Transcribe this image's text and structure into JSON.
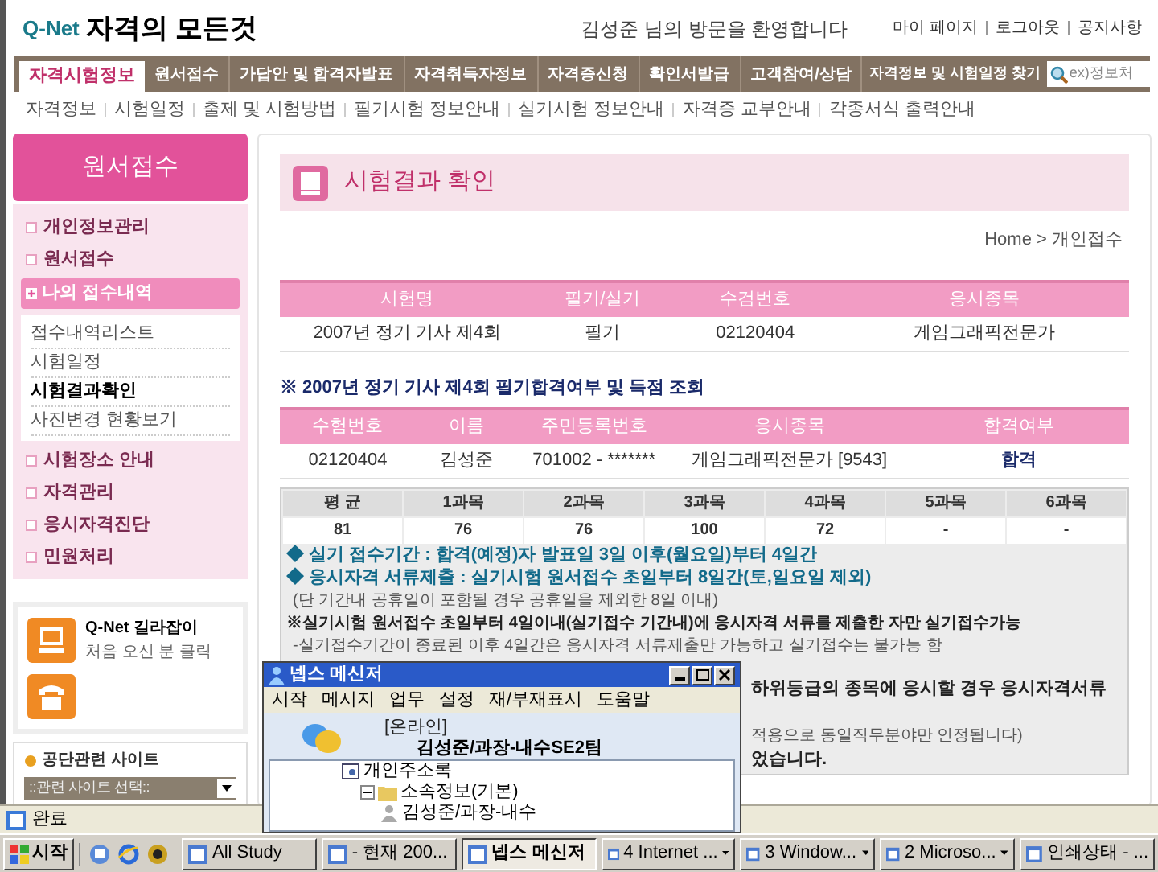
{
  "header": {
    "logo": "Q-Net",
    "site_title": "자격의 모든것",
    "welcome": "김성준 님의 방문을 환영합니다",
    "links": [
      "마이 페이지",
      "로그아웃",
      "공지사항"
    ]
  },
  "main_nav": {
    "tabs": [
      {
        "label": "자격시험정보",
        "selected": true
      },
      {
        "label": "원서접수",
        "selected": false
      },
      {
        "label": "가답안 및 합격자발표",
        "selected": false
      },
      {
        "label": "자격취득자정보",
        "selected": false
      },
      {
        "label": "자격증신청",
        "selected": false
      },
      {
        "label": "확인서발급",
        "selected": false
      },
      {
        "label": "고객참여/상담",
        "selected": false
      }
    ],
    "search_label": "자격정보 및 시험일정 찾기",
    "search_placeholder": "ex)정보처"
  },
  "sub_nav": [
    "자격정보",
    "시험일정",
    "출제 및 시험방법",
    "필기시험 정보안내",
    "실기시험 정보안내",
    "자격증 교부안내",
    "각종서식 출력안내"
  ],
  "sidebar": {
    "title": "원서접수",
    "items": [
      {
        "label": "개인정보관리",
        "expanded": false
      },
      {
        "label": "원서접수",
        "expanded": false
      },
      {
        "label": "나의 접수내역",
        "expanded": true,
        "children": [
          {
            "label": "접수내역리스트",
            "selected": false
          },
          {
            "label": "시험일정",
            "selected": false
          },
          {
            "label": "시험결과확인",
            "selected": true
          },
          {
            "label": "사진변경 현황보기",
            "selected": false
          }
        ]
      },
      {
        "label": "시험장소 안내",
        "expanded": false
      },
      {
        "label": "자격관리",
        "expanded": false
      },
      {
        "label": "응시자격진단",
        "expanded": false
      },
      {
        "label": "민원처리",
        "expanded": false
      }
    ],
    "guide": {
      "title": "Q-Net 길라잡이",
      "subtitle": "처음 오신 분 클릭"
    },
    "related_sites": {
      "title": "공단관련 사이트",
      "select": "::관련 사이트 선택::"
    }
  },
  "page_title": "시험결과 확인",
  "breadcrumb": "Home > 개인접수",
  "exam_table": {
    "columns": [
      "시험명",
      "필기/실기",
      "수검번호",
      "응시종목"
    ],
    "rows": [
      [
        "2007년 정기 기사 제4회",
        "필기",
        "02120404",
        "게임그래픽전문가"
      ]
    ]
  },
  "result_heading": "※ 2007년 정기 기사 제4회 필기합격여부 및 득점 조회",
  "result_table": {
    "columns": [
      "수험번호",
      "이름",
      "주민등록번호",
      "응시종목",
      "합격여부"
    ],
    "rows": [
      [
        "02120404",
        "김성준",
        "701002 - *******",
        "게임그래픽전문가 [9543]",
        "합격"
      ]
    ]
  },
  "score_table": {
    "columns": [
      "평 균",
      "1과목",
      "2과목",
      "3과목",
      "4과목",
      "5과목",
      "6과목"
    ],
    "values": [
      "81",
      "76",
      "76",
      "100",
      "72",
      "-",
      "-"
    ]
  },
  "notes": [
    {
      "kind": "highlight",
      "text": "◆ 실기 접수기간 : 합격(예정)자 발표일 3일 이후(월요일)부터 4일간"
    },
    {
      "kind": "highlight",
      "text": "◆ 응시자격 서류제출 : 실기시험 원서접수 초일부터 8일간(토,일요일 제외)"
    },
    {
      "kind": "note",
      "text": "(단 기간내 공휴일이 포함될 경우 공휴일을 제외한 8일 이내)"
    },
    {
      "kind": "warning",
      "text": "※실기시험 원서접수 초일부터 4일이내(실기접수 기간내)에 응시자격 서류를 제출한 자만 실기접수가능"
    },
    {
      "kind": "note",
      "text": "-실기접수기간이 종료된 이후 4일간은 응시자격 서류제출만 가능하고 실기접수는 불가능 함"
    },
    {
      "kind": "covered_warning",
      "text": "하위등급의 종목에 응시할 경우 응시자격서류"
    },
    {
      "kind": "covered_note",
      "text": "적용으로 동일직무분야만 인정됩니다)"
    },
    {
      "kind": "covered_end",
      "text": "었습니다."
    }
  ],
  "status_bar": "완료",
  "messenger": {
    "title": "넵스 메신저",
    "menu": [
      "시작",
      "메시지",
      "업무",
      "설정",
      "재/부재표시",
      "도움말"
    ],
    "status": "[온라인]",
    "user": "김성준/과장-내수SE2팀",
    "tree": [
      {
        "label": "개인주소록",
        "children": [
          {
            "label": "소속정보(기본)",
            "expanded": true,
            "children": [
              {
                "label": "김성준/과장-내수"
              }
            ]
          }
        ]
      }
    ]
  },
  "taskbar": {
    "start": "시작",
    "tasks": [
      {
        "label": "All Study",
        "kind": "window",
        "selected": false
      },
      {
        "label": "- 현재 200...",
        "kind": "window",
        "selected": false
      },
      {
        "label": "넵스 메신저",
        "kind": "window",
        "selected": true
      },
      {
        "label": "4 Internet ...",
        "kind": "group",
        "selected": false
      },
      {
        "label": "3 Window...",
        "kind": "group",
        "selected": false
      },
      {
        "label": "2 Microso...",
        "kind": "group",
        "selected": false
      },
      {
        "label": "인쇄상태 - ...",
        "kind": "window",
        "selected": false
      }
    ]
  }
}
